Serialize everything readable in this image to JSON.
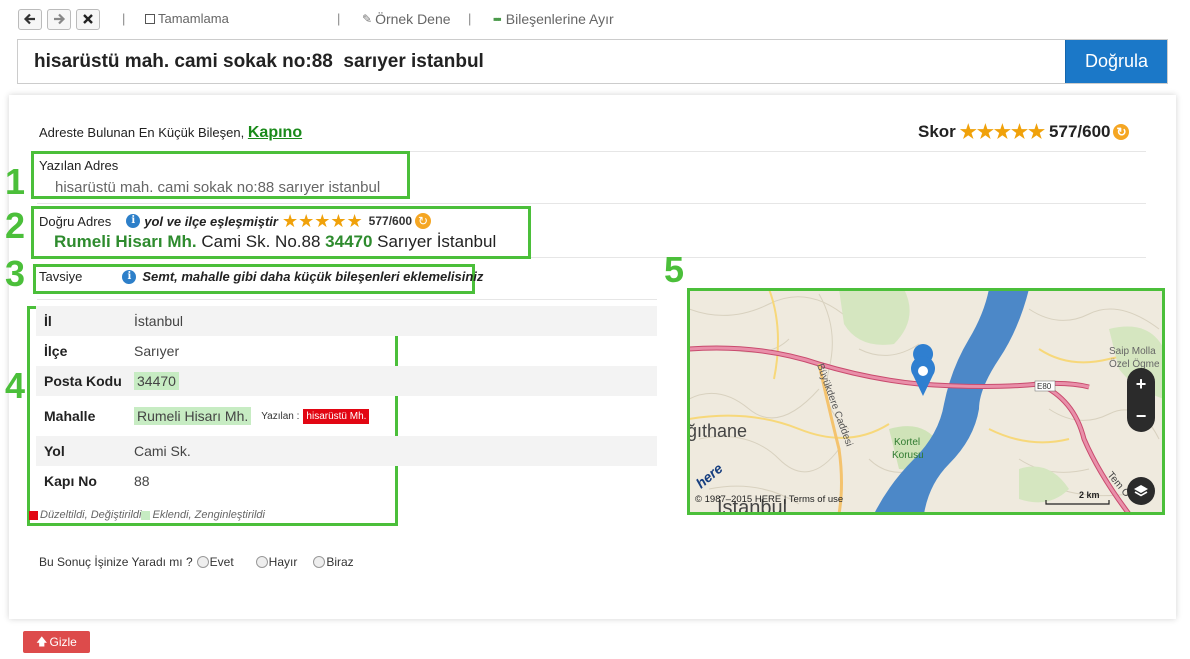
{
  "toolbar": {
    "complete_label": "Tamamlama",
    "sample_label": "Örnek Dene",
    "split_label": "Bileşenlerine Ayır",
    "separator": "|"
  },
  "search": {
    "value": "hisarüstü mah. cami sokak no:88  sarıyer istanbul",
    "button_label": "Doğrula"
  },
  "result": {
    "smallest_prefix": "Adreste Bulunan En Küçük Bileşen,",
    "smallest_value": "Kapıno",
    "score_label": "Skor",
    "score_value": "577/600",
    "stars": 5
  },
  "numbers": [
    "1",
    "2",
    "3",
    "4",
    "5"
  ],
  "written": {
    "label": "Yazılan Adres",
    "value": "hisarüstü mah. cami sokak no:88 sarıyer istanbul"
  },
  "correct": {
    "label": "Doğru Adres",
    "match_text": "yol ve ilçe eşleşmiştir",
    "score": "577/600",
    "neighbourhood": "Rumeli Hisarı Mh.",
    "street": "Cami Sk. No.88",
    "postcode": "34470",
    "city": "Sarıyer İstanbul"
  },
  "advice": {
    "label": "Tavsiye",
    "text": "Semt, mahalle gibi daha küçük bileşenleri eklemelisiniz"
  },
  "components": [
    {
      "key": "İl",
      "value": "İstanbul"
    },
    {
      "key": "İlçe",
      "value": "Sarıyer"
    },
    {
      "key": "Posta Kodu",
      "value": "34470"
    },
    {
      "key": "Mahalle",
      "value": "Rumeli Hisarı Mh.",
      "written_label": "Yazılan :",
      "written_value": "hisarüstü Mh."
    },
    {
      "key": "Yol",
      "value": "Cami Sk."
    },
    {
      "key": "Kapı No",
      "value": "88"
    }
  ],
  "legend": {
    "changed": "Düzeltildi, Değiştirildi",
    "added": "Eklendi, Zenginleştirildi"
  },
  "feedback": {
    "question": "Bu Sonuç İşinize Yaradı mı ?",
    "yes": "Evet",
    "no": "Hayır",
    "some": "Biraz"
  },
  "map": {
    "place_kagithane": "ğıthane",
    "place_istanbul": "İstanbul",
    "road_buyukdere": "Büyükdere Caddesi",
    "park": "Kortel",
    "park2": "Korusu",
    "saip": "Saip Molla",
    "ozel": "Özel Ögme",
    "e80": "E80",
    "tem": "Tem O",
    "here": "here",
    "copyright": "© 1987–2015 HERE | Terms of use",
    "scale": "2 km"
  },
  "hide_label": "Gizle",
  "colors": {
    "accent_blue": "#1b78c8",
    "annotation_green": "#4bbf3a",
    "match_green": "#2e8b2e",
    "error_red": "#e20613",
    "star_orange": "#f0a10a"
  }
}
